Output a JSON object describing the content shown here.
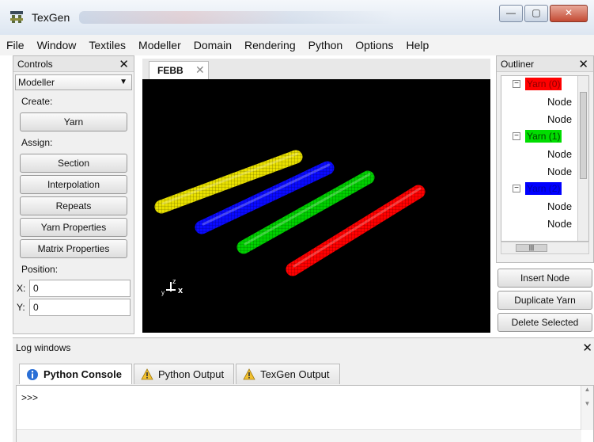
{
  "window": {
    "title": "TexGen",
    "controls": {
      "minimize": "—",
      "maximize": "▢",
      "close": "✕"
    }
  },
  "menu": [
    "File",
    "Window",
    "Textiles",
    "Modeller",
    "Domain",
    "Rendering",
    "Python",
    "Options",
    "Help"
  ],
  "controls_panel": {
    "title": "Controls",
    "close": "✕",
    "mode": "Modeller",
    "create_label": "Create:",
    "create_buttons": [
      "Yarn"
    ],
    "assign_label": "Assign:",
    "assign_buttons": [
      "Section",
      "Interpolation",
      "Repeats",
      "Yarn Properties",
      "Matrix Properties"
    ],
    "position_label": "Position:",
    "position": {
      "x_label": "X:",
      "x": "0",
      "y_label": "Y:",
      "y": "0"
    }
  },
  "viewport": {
    "tab": "FEBB",
    "tab_close": "✕",
    "yarns_colors": [
      "#e8e000",
      "#0a0aff",
      "#00d000",
      "#ff0000"
    ],
    "axis_labels": {
      "y": "y",
      "z": "z",
      "x": "x"
    }
  },
  "outliner": {
    "title": "Outliner",
    "close": "✕",
    "items": [
      {
        "label": "Yarn (0)",
        "color": "#ff0000",
        "text_color": "#8b0000",
        "nodes": [
          "Node",
          "Node"
        ]
      },
      {
        "label": "Yarn (1)",
        "color": "#00dd00",
        "text_color": "#004400",
        "nodes": [
          "Node",
          "Node"
        ]
      },
      {
        "label": "Yarn (2)",
        "color": "#0000ff",
        "text_color": "#0000aa",
        "nodes": [
          "Node",
          "Node"
        ]
      }
    ],
    "buttons": [
      "Insert Node",
      "Duplicate Yarn",
      "Delete Selected"
    ]
  },
  "log": {
    "title": "Log windows",
    "close": "✕",
    "tabs": [
      {
        "label": "Python Console",
        "icon": "info-icon",
        "active": true
      },
      {
        "label": "Python Output",
        "icon": "warning-icon",
        "active": false
      },
      {
        "label": "TexGen Output",
        "icon": "warning-icon",
        "active": false
      }
    ],
    "prompt": ">>>"
  }
}
